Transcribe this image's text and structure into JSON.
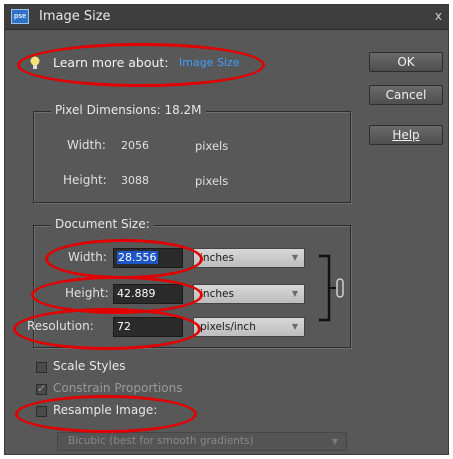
{
  "window": {
    "app_icon_text": "pse",
    "title": "Image Size",
    "close_glyph": "x"
  },
  "learn_more": {
    "label": "Learn more about:",
    "link": "Image Size"
  },
  "buttons": {
    "ok": "OK",
    "cancel": "Cancel",
    "help": "Help"
  },
  "pixel_dimensions": {
    "legend": "Pixel Dimensions: 18.2M",
    "width_label": "Width:",
    "width_value": "2056",
    "width_unit": "pixels",
    "height_label": "Height:",
    "height_value": "3088",
    "height_unit": "pixels"
  },
  "document_size": {
    "legend": "Document Size:",
    "width_label": "Width:",
    "width_value": "28.556",
    "width_unit": "inches",
    "height_label": "Height:",
    "height_value": "42.889",
    "height_unit": "inches",
    "resolution_label": "Resolution:",
    "resolution_value": "72",
    "resolution_unit": "pixels/inch"
  },
  "options": {
    "scale_styles": {
      "label": "Scale Styles",
      "checked": false
    },
    "constrain_proportions": {
      "label": "Constrain Proportions",
      "checked": true,
      "disabled": true
    },
    "resample_image": {
      "label": "Resample Image:",
      "checked": false
    },
    "resample_method": "Bicubic (best for smooth gradients)"
  },
  "colors": {
    "dialog_bg": "#585858",
    "title_bar": "#3e3e3e",
    "link": "#3ea0ff",
    "selection": "#1f56c7",
    "highlight_ellipse": "#e20000"
  },
  "icons": [
    "app-icon",
    "lightbulb-icon",
    "close-icon",
    "dropdown-arrow-icon",
    "chain-link-icon",
    "checkmark-icon"
  ]
}
